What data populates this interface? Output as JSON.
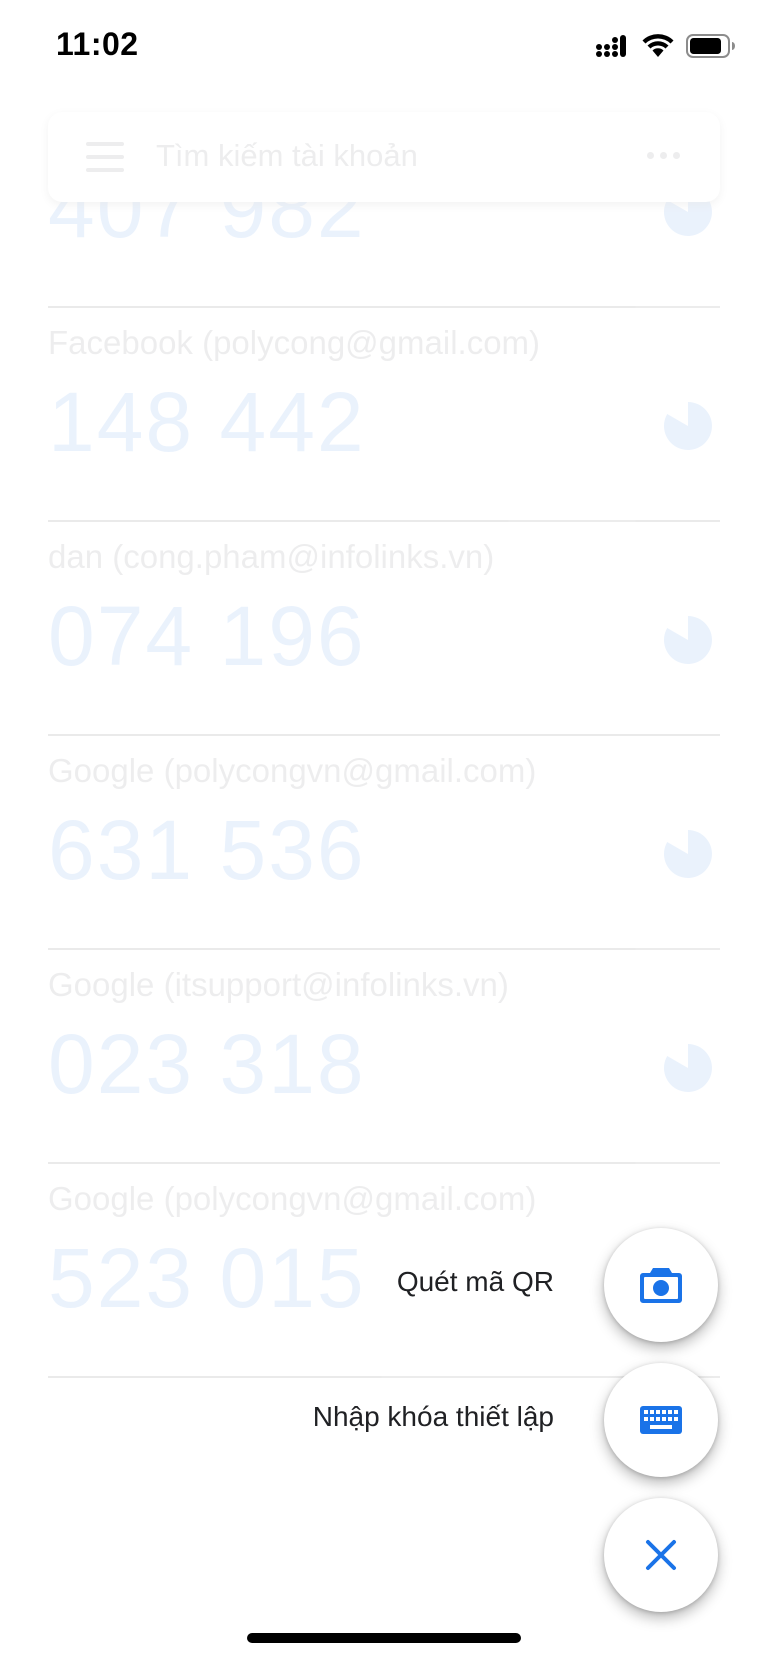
{
  "status_bar": {
    "time": "11:02",
    "signal_icon": "signal-icon",
    "wifi_icon": "wifi-icon",
    "battery_icon": "battery-icon"
  },
  "search": {
    "placeholder": "Tìm kiếm tài khoản",
    "menu_icon": "menu-icon",
    "more_icon": "more-icon"
  },
  "accounts": [
    {
      "label": "",
      "code": "407 982"
    },
    {
      "label": "Facebook (polycong@gmail.com)",
      "code": "148 442"
    },
    {
      "label": "dan (cong.pham@infolinks.vn)",
      "code": "074 196"
    },
    {
      "label": "Google (polycongvn@gmail.com)",
      "code": "631 536"
    },
    {
      "label": "Google (itsupport@infolinks.vn)",
      "code": "023 318"
    },
    {
      "label": "Google (polycongvn@gmail.com)",
      "code": "523 015"
    }
  ],
  "speed_dial": {
    "scan_qr_label": "Quét mã QR",
    "scan_qr_icon": "camera-icon",
    "enter_key_label": "Nhập khóa thiết lập",
    "enter_key_icon": "keyboard-icon",
    "close_icon": "close-icon"
  },
  "colors": {
    "accent": "#1a73e8",
    "text": "#202124"
  }
}
